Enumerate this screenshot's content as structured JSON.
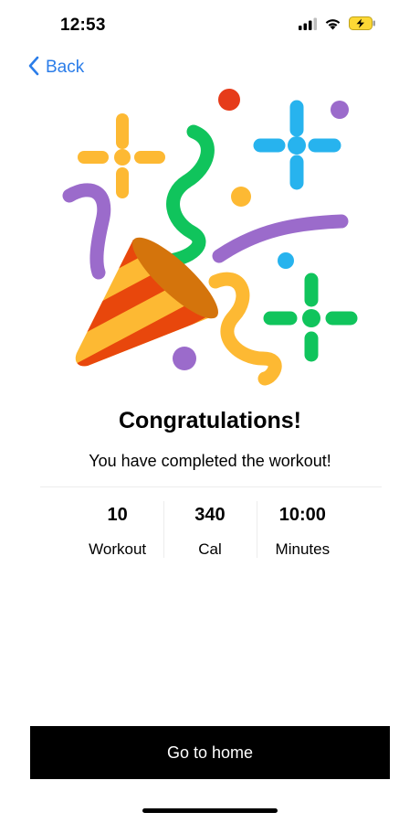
{
  "status_bar": {
    "time": "12:53",
    "icons": [
      "cellular-signal-icon",
      "wifi-icon",
      "battery-charging-icon"
    ]
  },
  "nav": {
    "back_label": "Back",
    "back_icon": "chevron-left-icon"
  },
  "illustration": {
    "icon": "party-popper-icon",
    "colors": {
      "yellow": "#FDB933",
      "orange": "#E8470C",
      "purple": "#9B6BCB",
      "green": "#10C45C",
      "blue": "#27B3EE",
      "red": "#E63B1A"
    }
  },
  "content": {
    "title": "Congratulations!",
    "subtitle": "You have completed the workout!",
    "stats": [
      {
        "value": "10",
        "label": "Workout"
      },
      {
        "value": "340",
        "label": "Cal"
      },
      {
        "value": "10:00",
        "label": "Minutes"
      }
    ]
  },
  "actions": {
    "home_label": "Go to home"
  },
  "theme": {
    "accent": "#2B7DE9",
    "button_bg": "#000000",
    "button_text": "#FFFFFF"
  }
}
